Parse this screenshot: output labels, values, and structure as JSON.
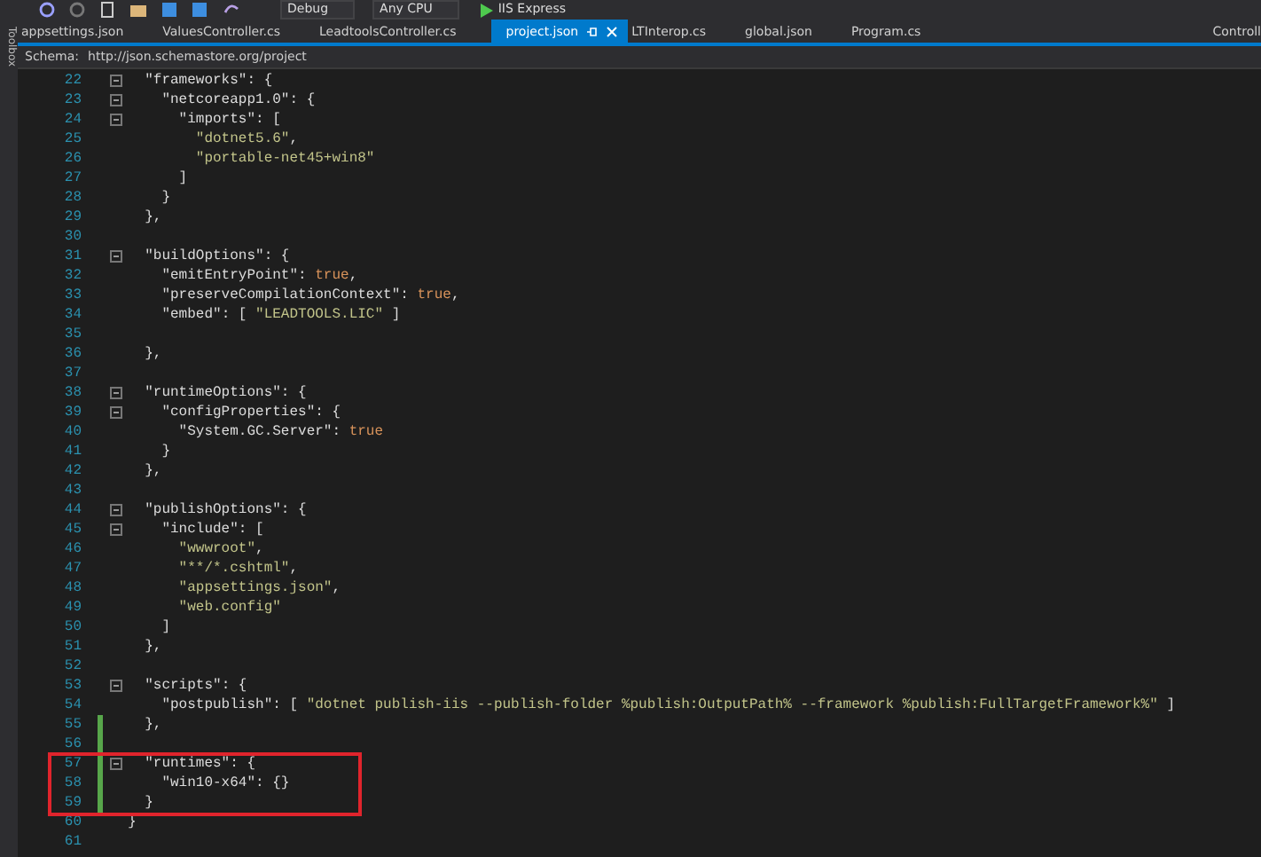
{
  "toolbar": [
    {
      "kind": "dropdown",
      "label": "Debug"
    },
    {
      "kind": "dropdown",
      "label": "Any CPU"
    },
    {
      "kind": "run",
      "label": "IIS Express"
    }
  ],
  "side_panel": {
    "label": "Toolbox"
  },
  "tabs": [
    {
      "label": "appsettings.json",
      "selected": false
    },
    {
      "label": "ValuesController.cs",
      "selected": false
    },
    {
      "label": "LeadtoolsController.cs",
      "selected": false
    },
    {
      "label": "project.json",
      "selected": true
    },
    {
      "label": "LTInterop.cs",
      "selected": false
    },
    {
      "label": "global.json",
      "selected": false
    },
    {
      "label": "Program.cs",
      "selected": false
    },
    {
      "label": "Controll",
      "selected": false
    }
  ],
  "schema_bar": {
    "label": "Schema:",
    "url": "http://json.schemastore.org/project"
  },
  "editor": {
    "segments": [
      {
        "kind": "plain",
        "lines": [
          {
            "number": "22",
            "fold": true,
            "changed": false,
            "tokens": [
              {
                "kind": "key",
                "text": "  \"frameworks\""
              },
              {
                "kind": "punct",
                "text": ": {"
              }
            ]
          },
          {
            "number": "23",
            "fold": true,
            "changed": false,
            "tokens": [
              {
                "kind": "key",
                "text": "    \"netcoreapp1.0\""
              },
              {
                "kind": "punct",
                "text": ": {"
              }
            ]
          },
          {
            "number": "24",
            "fold": true,
            "changed": false,
            "tokens": [
              {
                "kind": "key",
                "text": "      \"imports\""
              },
              {
                "kind": "punct",
                "text": ": ["
              }
            ]
          },
          {
            "number": "25",
            "fold": false,
            "changed": false,
            "tokens": [
              {
                "kind": "string",
                "text": "        \"dotnet5.6\""
              },
              {
                "kind": "punct",
                "text": ","
              }
            ]
          },
          {
            "number": "26",
            "fold": false,
            "changed": false,
            "tokens": [
              {
                "kind": "string",
                "text": "        \"portable-net45+win8\""
              }
            ]
          },
          {
            "number": "27",
            "fold": false,
            "changed": false,
            "tokens": [
              {
                "kind": "punct",
                "text": "      ]"
              }
            ]
          },
          {
            "number": "28",
            "fold": false,
            "changed": false,
            "tokens": [
              {
                "kind": "punct",
                "text": "    }"
              }
            ]
          },
          {
            "number": "29",
            "fold": false,
            "changed": false,
            "tokens": [
              {
                "kind": "punct",
                "text": "  },"
              }
            ]
          },
          {
            "number": "30",
            "fold": false,
            "changed": false
          },
          {
            "number": "31",
            "fold": true,
            "changed": false,
            "tokens": [
              {
                "kind": "key",
                "text": "  \"buildOptions\""
              },
              {
                "kind": "punct",
                "text": ": {"
              }
            ]
          },
          {
            "number": "32",
            "fold": false,
            "changed": false,
            "tokens": [
              {
                "kind": "key",
                "text": "    \"emitEntryPoint\""
              },
              {
                "kind": "punct",
                "text": ": "
              },
              {
                "kind": "literal",
                "text": "true"
              },
              {
                "kind": "punct",
                "text": ","
              }
            ]
          },
          {
            "number": "33",
            "fold": false,
            "changed": false,
            "tokens": [
              {
                "kind": "key",
                "text": "    \"preserveCompilationContext\""
              },
              {
                "kind": "punct",
                "text": ": "
              },
              {
                "kind": "literal",
                "text": "true"
              },
              {
                "kind": "punct",
                "text": ","
              }
            ]
          },
          {
            "number": "34",
            "fold": false,
            "changed": false,
            "tokens": [
              {
                "kind": "key",
                "text": "    \"embed\""
              },
              {
                "kind": "punct",
                "text": ": [ "
              },
              {
                "kind": "string",
                "text": "\"LEADTOOLS.LIC\""
              },
              {
                "kind": "punct",
                "text": " ]"
              }
            ]
          },
          {
            "number": "35",
            "fold": false,
            "changed": false
          },
          {
            "number": "36",
            "fold": false,
            "changed": false,
            "tokens": [
              {
                "kind": "punct",
                "text": "  },"
              }
            ]
          },
          {
            "number": "37",
            "fold": false,
            "changed": false
          },
          {
            "number": "38",
            "fold": true,
            "changed": false,
            "tokens": [
              {
                "kind": "key",
                "text": "  \"runtimeOptions\""
              },
              {
                "kind": "punct",
                "text": ": {"
              }
            ]
          },
          {
            "number": "39",
            "fold": true,
            "changed": false,
            "tokens": [
              {
                "kind": "key",
                "text": "    \"configProperties\""
              },
              {
                "kind": "punct",
                "text": ": {"
              }
            ]
          },
          {
            "number": "40",
            "fold": false,
            "changed": false,
            "tokens": [
              {
                "kind": "key",
                "text": "      \"System.GC.Server\""
              },
              {
                "kind": "punct",
                "text": ": "
              },
              {
                "kind": "literal",
                "text": "true"
              }
            ]
          },
          {
            "number": "41",
            "fold": false,
            "changed": false,
            "tokens": [
              {
                "kind": "punct",
                "text": "    }"
              }
            ]
          },
          {
            "number": "42",
            "fold": false,
            "changed": false,
            "tokens": [
              {
                "kind": "punct",
                "text": "  },"
              }
            ]
          },
          {
            "number": "43",
            "fold": false,
            "changed": false
          },
          {
            "number": "44",
            "fold": true,
            "changed": false,
            "tokens": [
              {
                "kind": "key",
                "text": "  \"publishOptions\""
              },
              {
                "kind": "punct",
                "text": ": {"
              }
            ]
          },
          {
            "number": "45",
            "fold": true,
            "changed": false,
            "tokens": [
              {
                "kind": "key",
                "text": "    \"include\""
              },
              {
                "kind": "punct",
                "text": ": ["
              }
            ]
          },
          {
            "number": "46",
            "fold": false,
            "changed": false,
            "tokens": [
              {
                "kind": "string",
                "text": "      \"wwwroot\""
              },
              {
                "kind": "punct",
                "text": ","
              }
            ]
          },
          {
            "number": "47",
            "fold": false,
            "changed": false,
            "tokens": [
              {
                "kind": "string",
                "text": "      \"**/*.cshtml\""
              },
              {
                "kind": "punct",
                "text": ","
              }
            ]
          },
          {
            "number": "48",
            "fold": false,
            "changed": false,
            "tokens": [
              {
                "kind": "string",
                "text": "      \"appsettings.json\""
              },
              {
                "kind": "punct",
                "text": ","
              }
            ]
          },
          {
            "number": "49",
            "fold": false,
            "changed": false,
            "tokens": [
              {
                "kind": "string",
                "text": "      \"web.config\""
              }
            ]
          },
          {
            "number": "50",
            "fold": false,
            "changed": false,
            "tokens": [
              {
                "kind": "punct",
                "text": "    ]"
              }
            ]
          },
          {
            "number": "51",
            "fold": false,
            "changed": false,
            "tokens": [
              {
                "kind": "punct",
                "text": "  },"
              }
            ]
          },
          {
            "number": "52",
            "fold": false,
            "changed": false
          },
          {
            "number": "53",
            "fold": true,
            "changed": false,
            "tokens": [
              {
                "kind": "key",
                "text": "  \"scripts\""
              },
              {
                "kind": "punct",
                "text": ": {"
              }
            ]
          },
          {
            "number": "54",
            "fold": false,
            "changed": false,
            "tokens": [
              {
                "kind": "key",
                "text": "    \"postpublish\""
              },
              {
                "kind": "punct",
                "text": ": [ "
              },
              {
                "kind": "string",
                "text": "\"dotnet publish-iis --publish-folder %publish:OutputPath% --framework %publish:FullTargetFramework%\""
              },
              {
                "kind": "punct",
                "text": " ]"
              }
            ]
          },
          {
            "number": "55",
            "fold": false,
            "changed": true,
            "tokens": [
              {
                "kind": "punct",
                "text": "  },"
              }
            ]
          },
          {
            "number": "56",
            "fold": false,
            "changed": true
          }
        ]
      },
      {
        "kind": "boxed",
        "lines": [
          {
            "number": "57",
            "fold": true,
            "changed": true,
            "tokens": [
              {
                "kind": "key",
                "text": "  \"runtimes\""
              },
              {
                "kind": "punct",
                "text": ": {"
              }
            ]
          },
          {
            "number": "58",
            "fold": false,
            "changed": true,
            "tokens": [
              {
                "kind": "key",
                "text": "    \"win10-x64\""
              },
              {
                "kind": "punct",
                "text": ": {}"
              }
            ]
          },
          {
            "number": "59",
            "fold": false,
            "changed": true,
            "tokens": [
              {
                "kind": "punct",
                "text": "  }"
              }
            ]
          }
        ]
      },
      {
        "kind": "plain",
        "lines": [
          {
            "number": "60",
            "fold": false,
            "changed": false,
            "tokens": [
              {
                "kind": "punct",
                "text": "}"
              }
            ]
          },
          {
            "number": "61",
            "fold": false,
            "changed": false
          }
        ]
      }
    ]
  }
}
